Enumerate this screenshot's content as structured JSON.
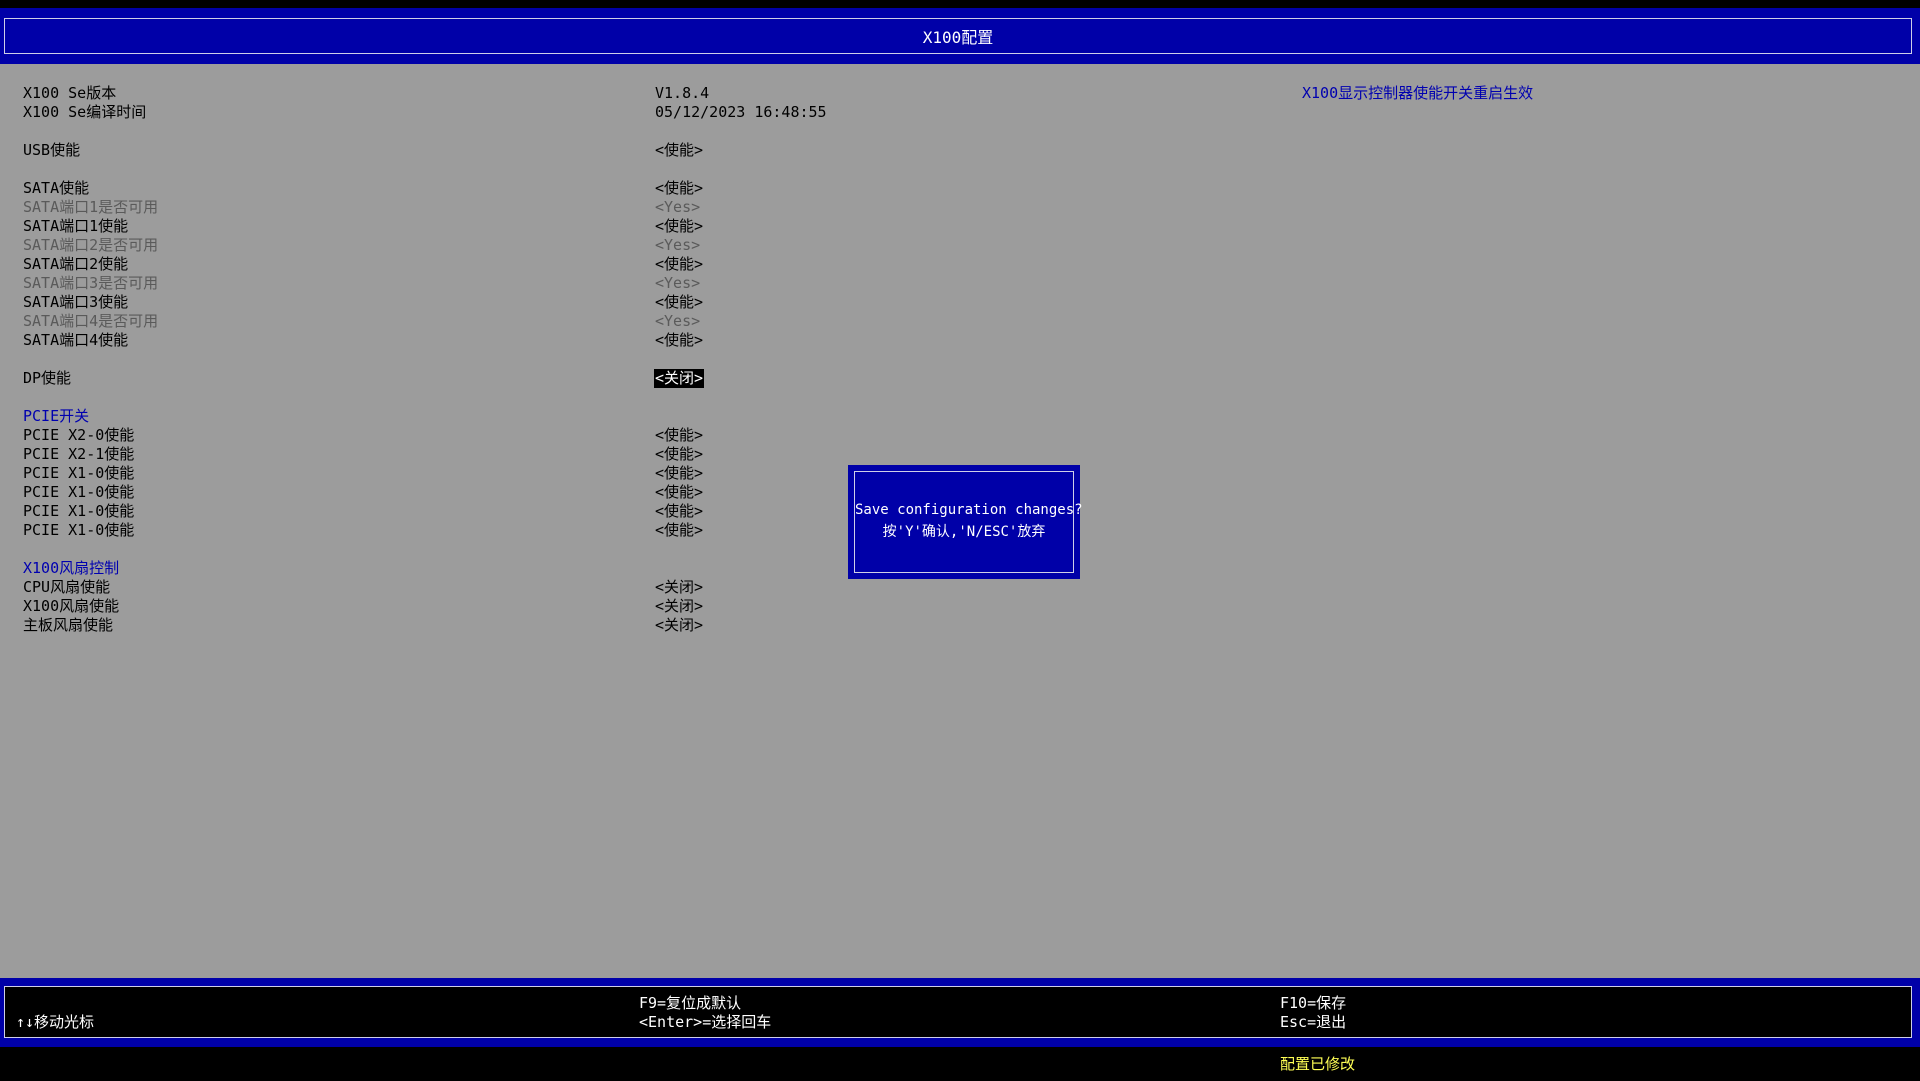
{
  "header": {
    "title": "X100配置"
  },
  "settings": {
    "se_version": {
      "label": "X100 Se版本",
      "value": "V1.8.4"
    },
    "se_build_time": {
      "label": "X100 Se编译时间",
      "value": "05/12/2023 16:48:55"
    },
    "usb_enable": {
      "label": "USB使能",
      "value": "<使能>"
    },
    "sata_enable": {
      "label": "SATA使能",
      "value": "<使能>"
    },
    "sata_port1_available": {
      "label": "SATA端口1是否可用",
      "value": "<Yes>"
    },
    "sata_port1_enable": {
      "label": "SATA端口1使能",
      "value": "<使能>"
    },
    "sata_port2_available": {
      "label": "SATA端口2是否可用",
      "value": "<Yes>"
    },
    "sata_port2_enable": {
      "label": "SATA端口2使能",
      "value": "<使能>"
    },
    "sata_port3_available": {
      "label": "SATA端口3是否可用",
      "value": "<Yes>"
    },
    "sata_port3_enable": {
      "label": "SATA端口3使能",
      "value": "<使能>"
    },
    "sata_port4_available": {
      "label": "SATA端口4是否可用",
      "value": "<Yes>"
    },
    "sata_port4_enable": {
      "label": "SATA端口4使能",
      "value": "<使能>"
    },
    "dp_enable": {
      "label": "DP使能",
      "value": "<关闭>"
    },
    "pcie_section": {
      "label": "PCIE开关"
    },
    "pcie_x2_0": {
      "label": "PCIE X2-0使能",
      "value": "<使能>"
    },
    "pcie_x2_1": {
      "label": "PCIE X2-1使能",
      "value": "<使能>"
    },
    "pcie_x1_0_a": {
      "label": "PCIE X1-0使能",
      "value": "<使能>"
    },
    "pcie_x1_0_b": {
      "label": "PCIE X1-0使能",
      "value": "<使能>"
    },
    "pcie_x1_0_c": {
      "label": "PCIE X1-0使能",
      "value": "<使能>"
    },
    "pcie_x1_0_d": {
      "label": "PCIE X1-0使能",
      "value": "<使能>"
    },
    "fan_section": {
      "label": "X100风扇控制"
    },
    "cpu_fan": {
      "label": "CPU风扇使能",
      "value": "<关闭>"
    },
    "x100_fan": {
      "label": "X100风扇使能",
      "value": "<关闭>"
    },
    "board_fan": {
      "label": "主板风扇使能",
      "value": "<关闭>"
    }
  },
  "help": {
    "text": "X100显示控制器使能开关重启生效"
  },
  "dialog": {
    "line1": "Save configuration changes?",
    "line2": "按'Y'确认,'N/ESC'放弃"
  },
  "footer": {
    "move_cursor": "↑↓移动光标",
    "f9": "F9=复位成默认",
    "enter": "<Enter>=选择回车",
    "f10": "F10=保存",
    "esc": "Esc=退出"
  },
  "status": {
    "text": "配置已修改"
  },
  "colors": {
    "header_blue": "#0000a8",
    "panel_gray": "#9c9c9c",
    "section_blue": "#0000b0",
    "status_yellow": "#ffff55"
  }
}
